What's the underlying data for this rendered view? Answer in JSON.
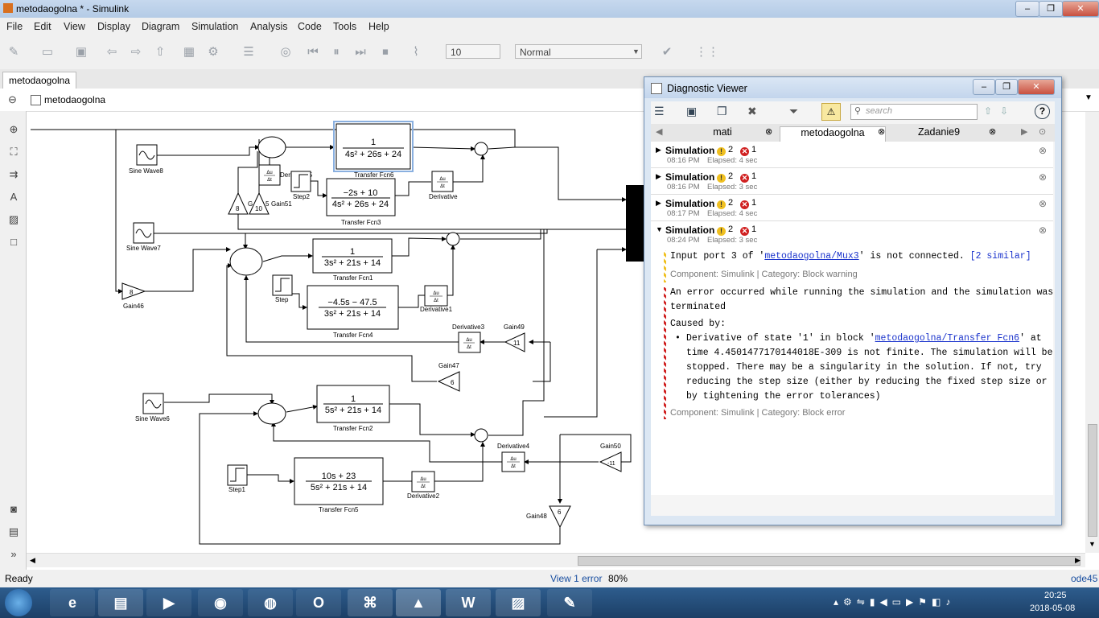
{
  "window": {
    "title": "metodaogolna * - Simulink",
    "min": "‒",
    "max": "❐",
    "close": "✕"
  },
  "menu": [
    "File",
    "Edit",
    "View",
    "Display",
    "Diagram",
    "Simulation",
    "Analysis",
    "Code",
    "Tools",
    "Help"
  ],
  "toolbar": {
    "stop_time": "10",
    "sim_mode": "Normal"
  },
  "model_tab": "metodaogolna",
  "breadcrumb": "metodaogolna",
  "diagram": {
    "blocks": {
      "sine8": "Sine Wave8",
      "sine7": "Sine Wave7",
      "sine6": "Sine Wave6",
      "tf6": "Transfer Fcn6",
      "tf3": "Transfer Fcn3",
      "tf1": "Transfer Fcn1",
      "tf4": "Transfer Fcn4",
      "tf2": "Transfer Fcn2",
      "tf5": "Transfer Fcn5",
      "deriv": "Derivative",
      "deriv1": "Derivative1",
      "deriv2": "Derivative2",
      "deriv3": "Derivative3",
      "deriv4": "Derivative4",
      "deriv5": "Derivative5",
      "step": "Step",
      "step1": "Step1",
      "step2": "Step2",
      "gain46": "Gain46",
      "gain47": "Gain47",
      "gain48": "Gain48",
      "gain49": "Gain49",
      "gain50": "Gain50",
      "gain51": "Gain51",
      "gain5x": "G",
      "g46v": "8",
      "g47v": "6",
      "g48v": "6",
      "g49v": "11",
      "g50v": "-11",
      "g8v": "8",
      "g10v": "10",
      "g5v": "5",
      "du": "Δu",
      "dt": "Δt"
    },
    "tf": {
      "tf6n": "1",
      "tf6d": "4s² + 26s + 24",
      "tf3n": "−2s + 10",
      "tf3d": "4s² + 26s + 24",
      "tf1n": "1",
      "tf1d": "3s² + 21s + 14",
      "tf4n": "−4.5s − 47.5",
      "tf4d": "3s² + 21s + 14",
      "tf2n": "1",
      "tf2d": "5s² + 21s + 14",
      "tf5n": "10s + 23",
      "tf5d": "5s² + 21s + 14"
    }
  },
  "diagnostic_viewer": {
    "title": "Diagnostic Viewer",
    "search_placeholder": "search",
    "tabs": [
      "mati",
      "metodaogolna",
      "Zadanie9"
    ],
    "runs": [
      {
        "label": "Simulation",
        "warnings": "2",
        "errors": "1",
        "time": "08:16 PM",
        "elapsed": "Elapsed: 4 sec"
      },
      {
        "label": "Simulation",
        "warnings": "2",
        "errors": "1",
        "time": "08:16 PM",
        "elapsed": "Elapsed: 3 sec"
      },
      {
        "label": "Simulation",
        "warnings": "2",
        "errors": "1",
        "time": "08:17 PM",
        "elapsed": "Elapsed: 4 sec"
      },
      {
        "label": "Simulation",
        "warnings": "2",
        "errors": "1",
        "time": "08:24 PM",
        "elapsed": "Elapsed: 3 sec"
      }
    ],
    "warning": {
      "pre": "Input port 3 of '",
      "link": "metodaogolna/Mux3",
      "post": "' is not connected. ",
      "similar": "[2 similar]",
      "meta": "Component: Simulink | Category: Block warning"
    },
    "error": {
      "line1": "An error occurred while running the simulation and the simulation was",
      "line2": "terminated",
      "caused": "Caused by:",
      "b_pre": "Derivative of state '1' in block '",
      "b_link": "metodaogolna/Transfer Fcn6",
      "b_post": "' at",
      "b2": "time 4.4501477170144018E-309 is not finite. The simulation will be",
      "b3": "stopped. There may be a singularity in the solution.  If not, try",
      "b4": "reducing the step size (either by reducing the fixed step size or",
      "b5": "by tightening the error tolerances)",
      "meta": "Component: Simulink | Category: Block error"
    }
  },
  "status": {
    "left": "Ready",
    "view_error": "View 1 error",
    "zoom": "80%",
    "solver": "ode45"
  },
  "taskbar": {
    "time": "20:25",
    "date": "2018-05-08"
  }
}
